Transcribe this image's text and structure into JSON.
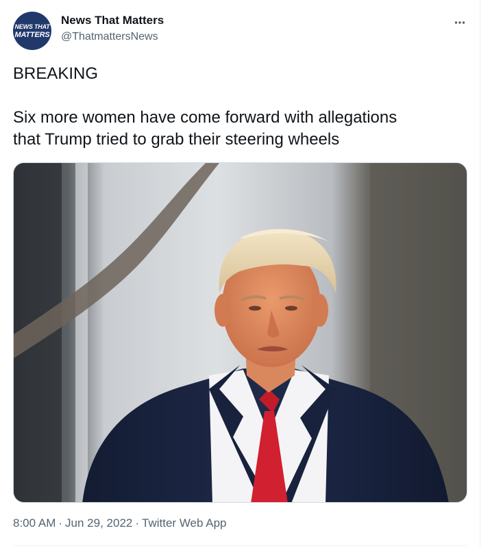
{
  "account": {
    "display_name": "News That Matters",
    "handle": "@ThatmattersNews",
    "avatar_line1": "NEWS THAT",
    "avatar_line2": "MATTERS"
  },
  "tweet": {
    "heading": "BREAKING",
    "body": "Six more women have come forward with allegations\nthat Trump tried to grab their steering wheels",
    "time": "8:00 AM",
    "date": "Jun 29, 2022",
    "source": "Twitter Web App",
    "separator": "·"
  },
  "icons": {
    "more": "more-horizontal-icon"
  },
  "colors": {
    "text_primary": "#0f1419",
    "text_secondary": "#536471",
    "avatar_bg": "#21386b",
    "divider": "#eff3f4",
    "tie_red": "#d1202f",
    "suit_navy": "#1c2744"
  }
}
